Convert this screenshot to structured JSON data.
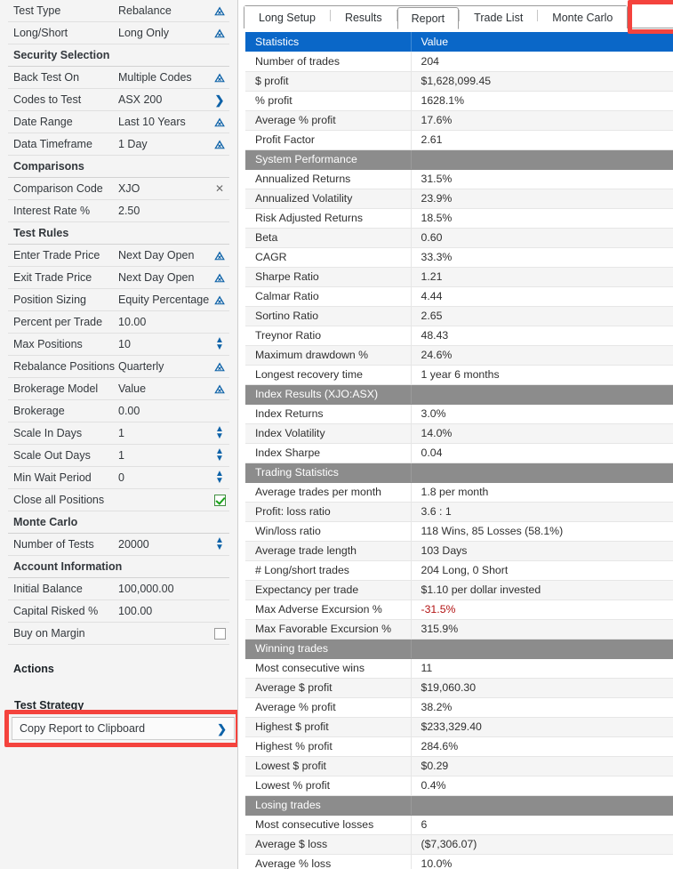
{
  "sidebar": {
    "rows": [
      {
        "label": "Test Type",
        "value": "Rebalance",
        "control": "chevron-down"
      },
      {
        "label": "Long/Short",
        "value": "Long Only",
        "control": "chevron-down"
      },
      {
        "label": "Security Selection",
        "value": "",
        "control": "none",
        "section": true
      },
      {
        "label": "Back Test On",
        "value": "Multiple Codes",
        "control": "chevron-down"
      },
      {
        "label": "Codes to Test",
        "value": "ASX 200",
        "control": "chevron-right"
      },
      {
        "label": "Date Range",
        "value": "Last 10 Years",
        "control": "chevron-down"
      },
      {
        "label": "Data Timeframe",
        "value": "1 Day",
        "control": "chevron-down"
      },
      {
        "label": "Comparisons",
        "value": "",
        "control": "none",
        "section": true
      },
      {
        "label": "Comparison Code",
        "value": "XJO",
        "control": "clear-x"
      },
      {
        "label": "Interest Rate %",
        "value": "2.50",
        "control": "none"
      },
      {
        "label": "Test Rules",
        "value": "",
        "control": "none",
        "section": true
      },
      {
        "label": "Enter Trade Price",
        "value": "Next Day Open",
        "control": "chevron-down"
      },
      {
        "label": "Exit Trade Price",
        "value": "Next Day Open",
        "control": "chevron-down"
      },
      {
        "label": "Position Sizing",
        "value": "Equity Percentage",
        "control": "chevron-down"
      },
      {
        "label": "Percent per Trade",
        "value": "10.00",
        "control": "none"
      },
      {
        "label": "Max Positions",
        "value": "10",
        "control": "spinner"
      },
      {
        "label": "Rebalance Positions",
        "value": "Quarterly",
        "control": "chevron-down"
      },
      {
        "label": "Brokerage Model",
        "value": "Value",
        "control": "chevron-down"
      },
      {
        "label": "Brokerage",
        "value": "0.00",
        "control": "none"
      },
      {
        "label": "Scale In Days",
        "value": "1",
        "control": "spinner"
      },
      {
        "label": "Scale Out Days",
        "value": "1",
        "control": "spinner"
      },
      {
        "label": "Min Wait Period",
        "value": "0",
        "control": "spinner"
      },
      {
        "label": "Close all Positions",
        "value": "",
        "control": "checkbox-checked"
      },
      {
        "label": "Monte Carlo",
        "value": "",
        "control": "none",
        "section": true
      },
      {
        "label": "Number of Tests",
        "value": "20000",
        "control": "spinner"
      },
      {
        "label": "Account Information",
        "value": "",
        "control": "none",
        "section": true
      },
      {
        "label": "Initial Balance",
        "value": "100,000.00",
        "control": "none"
      },
      {
        "label": "Capital Risked %",
        "value": "100.00",
        "control": "none"
      },
      {
        "label": "Buy on Margin",
        "value": "",
        "control": "checkbox-empty"
      }
    ],
    "actions_header": "Actions",
    "test_strategy_label": "Test Strategy",
    "copy_report_label": "Copy Report to Clipboard",
    "copy_report_icon": "chevron-right"
  },
  "tabs": [
    {
      "label": "Long Setup",
      "active": false
    },
    {
      "label": "Results",
      "active": false
    },
    {
      "label": "Report",
      "active": true
    },
    {
      "label": "Trade List",
      "active": false
    },
    {
      "label": "Monte Carlo",
      "active": false
    }
  ],
  "annotations": {
    "color": "#f4433d",
    "targets": [
      "Report",
      "Copy Report to Clipboard"
    ]
  },
  "report": {
    "columns": [
      "Statistics",
      "Value"
    ],
    "rows": [
      {
        "stat": "Number of trades",
        "value": "204"
      },
      {
        "stat": "$ profit",
        "value": "$1,628,099.45"
      },
      {
        "stat": "% profit",
        "value": "1628.1%"
      },
      {
        "stat": "Average % profit",
        "value": "17.6%"
      },
      {
        "stat": "Profit Factor",
        "value": "2.61"
      },
      {
        "stat": "System Performance",
        "value": "",
        "section": true
      },
      {
        "stat": "Annualized Returns",
        "value": "31.5%"
      },
      {
        "stat": "Annualized Volatility",
        "value": "23.9%"
      },
      {
        "stat": "Risk Adjusted Returns",
        "value": "18.5%"
      },
      {
        "stat": "Beta",
        "value": "0.60"
      },
      {
        "stat": "CAGR",
        "value": "33.3%"
      },
      {
        "stat": "Sharpe Ratio",
        "value": "1.21"
      },
      {
        "stat": "Calmar Ratio",
        "value": "4.44"
      },
      {
        "stat": "Sortino Ratio",
        "value": "2.65"
      },
      {
        "stat": "Treynor Ratio",
        "value": "48.43"
      },
      {
        "stat": "Maximum drawdown %",
        "value": "24.6%"
      },
      {
        "stat": "Longest recovery time",
        "value": "1 year 6 months"
      },
      {
        "stat": "Index Results (XJO:ASX)",
        "value": "",
        "section": true
      },
      {
        "stat": "Index Returns",
        "value": "3.0%"
      },
      {
        "stat": "Index Volatility",
        "value": "14.0%"
      },
      {
        "stat": "Index Sharpe",
        "value": "0.04"
      },
      {
        "stat": "Trading Statistics",
        "value": "",
        "section": true
      },
      {
        "stat": "Average trades per month",
        "value": "1.8 per month"
      },
      {
        "stat": "Profit: loss ratio",
        "value": "3.6 : 1"
      },
      {
        "stat": "Win/loss ratio",
        "value": "118 Wins, 85 Losses (58.1%)"
      },
      {
        "stat": "Average trade length",
        "value": "103 Days"
      },
      {
        "stat": "# Long/short trades",
        "value": "204 Long, 0 Short"
      },
      {
        "stat": "Expectancy per trade",
        "value": "$1.10 per dollar invested"
      },
      {
        "stat": "Max Adverse Excursion %",
        "value": "-31.5%",
        "negative": true
      },
      {
        "stat": "Max Favorable Excursion %",
        "value": "315.9%"
      },
      {
        "stat": "Winning trades",
        "value": "",
        "section": true
      },
      {
        "stat": "Most consecutive wins",
        "value": "11"
      },
      {
        "stat": "Average $ profit",
        "value": "$19,060.30"
      },
      {
        "stat": "Average % profit",
        "value": "38.2%"
      },
      {
        "stat": "Highest $ profit",
        "value": "$233,329.40"
      },
      {
        "stat": "Highest % profit",
        "value": "284.6%"
      },
      {
        "stat": "Lowest $ profit",
        "value": "$0.29"
      },
      {
        "stat": "Lowest % profit",
        "value": "0.4%"
      },
      {
        "stat": "Losing trades",
        "value": "",
        "section": true
      },
      {
        "stat": "Most consecutive losses",
        "value": "6"
      },
      {
        "stat": "Average $ loss",
        "value": "($7,306.07)"
      },
      {
        "stat": "Average % loss",
        "value": "10.0%"
      }
    ]
  }
}
